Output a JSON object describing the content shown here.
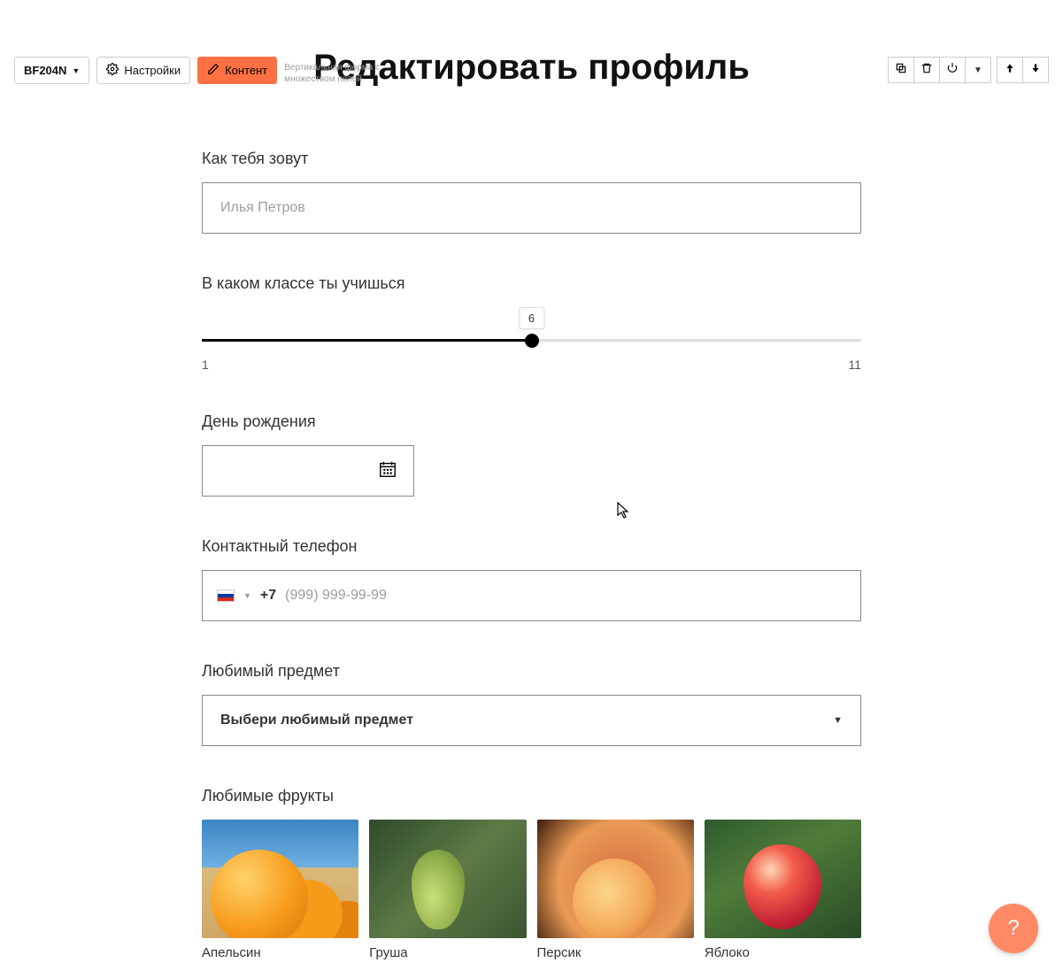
{
  "topbar": {
    "block_id": "BF204N",
    "settings_label": "Настройки",
    "content_label": "Контент",
    "description": "Вертикальная форма с множеством полей"
  },
  "page": {
    "title": "Редактировать профиль"
  },
  "form": {
    "name": {
      "label": "Как тебя зовут",
      "placeholder": "Илья Петров",
      "value": ""
    },
    "grade": {
      "label": "В каком классе ты учишься",
      "min": "1",
      "max": "11",
      "value": "6"
    },
    "birthday": {
      "label": "День рождения",
      "value": ""
    },
    "phone": {
      "label": "Контактный телефон",
      "prefix": "+7",
      "placeholder": "(999) 999-99-99",
      "value": ""
    },
    "subject": {
      "label": "Любимый предмет",
      "placeholder": "Выбери любимый предмет"
    },
    "fruits": {
      "label": "Любимые фрукты",
      "items": [
        {
          "label": "Апельсин"
        },
        {
          "label": "Груша"
        },
        {
          "label": "Персик"
        },
        {
          "label": "Яблоко"
        }
      ]
    }
  },
  "help": {
    "symbol": "?"
  }
}
